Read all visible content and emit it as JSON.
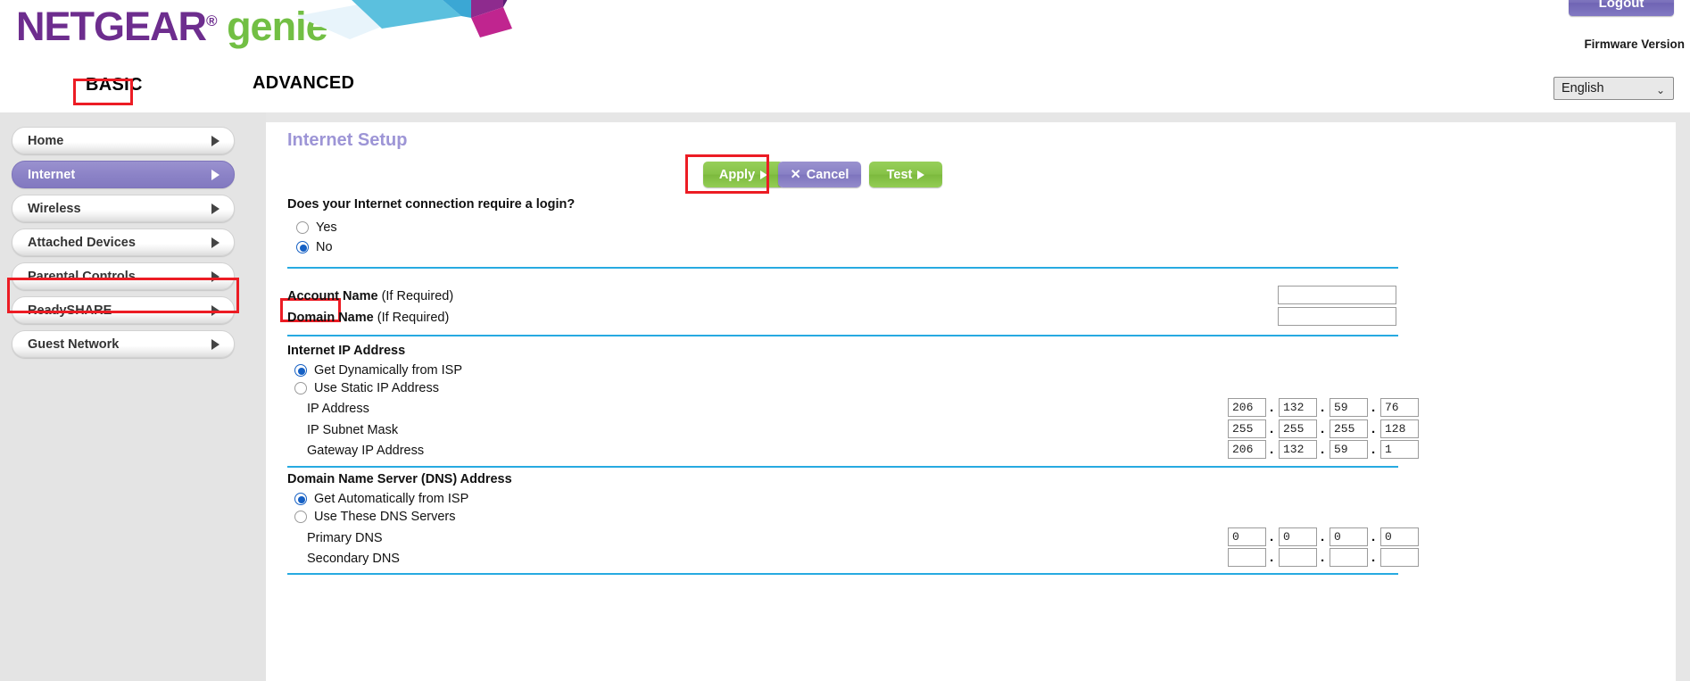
{
  "header": {
    "brand_netgear": "NETGEAR",
    "brand_reg": "®",
    "brand_genie": "genie",
    "brand_genie_reg": "®",
    "logout_label": "Logout",
    "firmware_label": "Firmware Version",
    "language_value": "English",
    "language_options": [
      "English"
    ],
    "chevron": "⌄",
    "colors": {
      "purple": "#6d2d8e",
      "green": "#72bf44",
      "accent_blue": "#27aae1",
      "highlight_red": "#ec1c24"
    }
  },
  "tabs": [
    {
      "label": "BASIC",
      "selected": true
    },
    {
      "label": "ADVANCED",
      "selected": false
    }
  ],
  "sidebar": {
    "items": [
      {
        "label": "Home",
        "active": false
      },
      {
        "label": "Internet",
        "active": true
      },
      {
        "label": "Wireless",
        "active": false
      },
      {
        "label": "Attached Devices",
        "active": false
      },
      {
        "label": "Parental Controls",
        "active": false
      },
      {
        "label": "ReadySHARE",
        "active": false
      },
      {
        "label": "Guest Network",
        "active": false
      }
    ]
  },
  "main": {
    "page_title": "Internet Setup",
    "buttons": {
      "apply": "Apply",
      "cancel": "Cancel",
      "test": "Test",
      "cancel_icon": "✕",
      "arrow_icon": "▶"
    },
    "login_question": "Does your Internet connection require a login?",
    "login_options": [
      {
        "label": "Yes",
        "selected": false
      },
      {
        "label": "No",
        "selected": true
      }
    ],
    "account_name": {
      "label": "Account Name",
      "hint": "(If Required)",
      "value": ""
    },
    "domain_name": {
      "label": "Domain Name",
      "hint": "(If Required)",
      "value": ""
    },
    "internet_ip": {
      "section_title": "Internet IP Address",
      "options": [
        {
          "label": "Get Dynamically from ISP",
          "selected": true
        },
        {
          "label": "Use Static IP Address",
          "selected": false
        }
      ],
      "fields": [
        {
          "label": "IP Address",
          "octets": [
            "206",
            "132",
            "59",
            "76"
          ]
        },
        {
          "label": "IP Subnet Mask",
          "octets": [
            "255",
            "255",
            "255",
            "128"
          ]
        },
        {
          "label": "Gateway IP Address",
          "octets": [
            "206",
            "132",
            "59",
            "1"
          ]
        }
      ]
    },
    "dns": {
      "section_title": "Domain Name Server (DNS) Address",
      "options": [
        {
          "label": "Get Automatically from ISP",
          "selected": true
        },
        {
          "label": "Use These DNS Servers",
          "selected": false
        }
      ],
      "fields": [
        {
          "label": "Primary DNS",
          "octets": [
            "0",
            "0",
            "0",
            "0"
          ]
        },
        {
          "label": "Secondary DNS",
          "octets": [
            "",
            "",
            "",
            ""
          ]
        }
      ]
    },
    "separator": "."
  }
}
